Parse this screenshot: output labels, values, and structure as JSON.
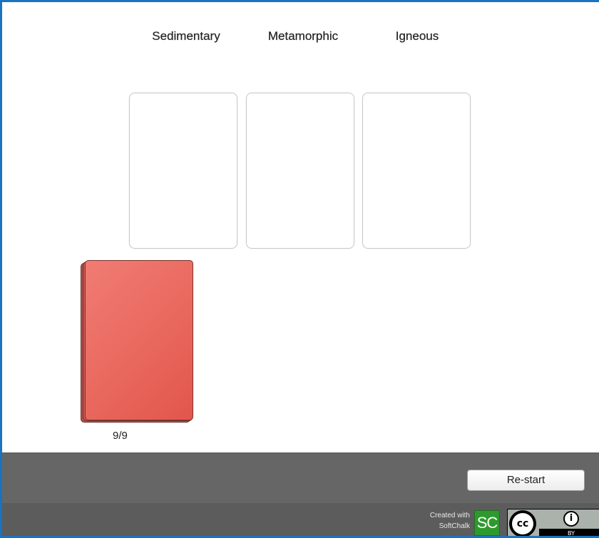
{
  "categories": [
    {
      "label": "Sedimentary"
    },
    {
      "label": "Metamorphic"
    },
    {
      "label": "Igneous"
    }
  ],
  "deck": {
    "counter": "9/9",
    "color": "#e8635a"
  },
  "controls": {
    "restart_label": "Re-start"
  },
  "footer": {
    "created_line1": "Created with",
    "created_line2": "SoftChalk",
    "softchalk_logo_text": "SC",
    "cc_text": "cc",
    "by_icon": "i",
    "by_label": "BY"
  },
  "colors": {
    "frame_border": "#1a73c0",
    "control_bar": "#666666",
    "footer_bar": "#5c5c5c",
    "softchalk_green": "#2e9a2e"
  }
}
